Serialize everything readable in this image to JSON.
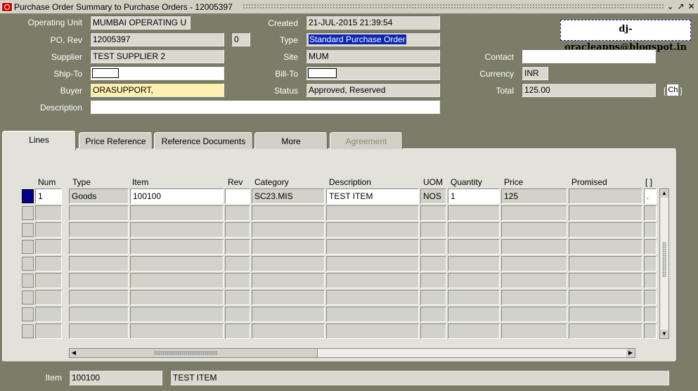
{
  "window": {
    "title": "Purchase Order Summary to Purchase Orders - 12005397",
    "controls": [
      "⌄",
      "↗",
      "✕"
    ]
  },
  "header": {
    "operating_unit_label": "Operating Unit",
    "operating_unit": "MUMBAI OPERATING U",
    "created_label": "Created",
    "created": "21-JUL-2015 21:39:54",
    "po_rev_label": "PO, Rev",
    "po_number": "12005397",
    "revision": "0",
    "type_label": "Type",
    "type": "Standard Purchase Order",
    "supplier_label": "Supplier",
    "supplier": "TEST SUPPLIER 2",
    "site_label": "Site",
    "site": "MUM",
    "contact_label": "Contact",
    "contact": "",
    "ship_to_label": "Ship-To",
    "bill_to_label": "Bill-To",
    "currency_label": "Currency",
    "currency": "INR",
    "buyer_label": "Buyer",
    "buyer": "ORASUPPORT,",
    "status_label": "Status",
    "status": "Approved, Reserved",
    "total_label": "Total",
    "total": "125.00",
    "total_btn": "Ch",
    "description_label": "Description",
    "description": ""
  },
  "note": "dj-oracleapps@blogspot.in",
  "tabs": [
    {
      "label": "Lines",
      "active": true
    },
    {
      "label": "Price Reference"
    },
    {
      "label": "Reference Documents"
    },
    {
      "label": "More"
    },
    {
      "label": "Agreement",
      "disabled": true
    }
  ],
  "lines": {
    "columns": {
      "num": "Num",
      "type": "Type",
      "item": "Item",
      "rev": "Rev",
      "category": "Category",
      "description": "Description",
      "uom": "UOM",
      "quantity": "Quantity",
      "price": "Price",
      "promised": "Promised",
      "extra": "[ ]"
    },
    "rows": [
      {
        "num": "1",
        "type": "Goods",
        "item": "100100",
        "rev": "",
        "category": "SC23.MIS",
        "description": "TEST ITEM",
        "uom": "NOS",
        "quantity": "1",
        "price": "125",
        "promised": "",
        "extra": "."
      }
    ]
  },
  "footer": {
    "item_label": "Item",
    "item": "100100",
    "item_desc": "TEST ITEM"
  }
}
